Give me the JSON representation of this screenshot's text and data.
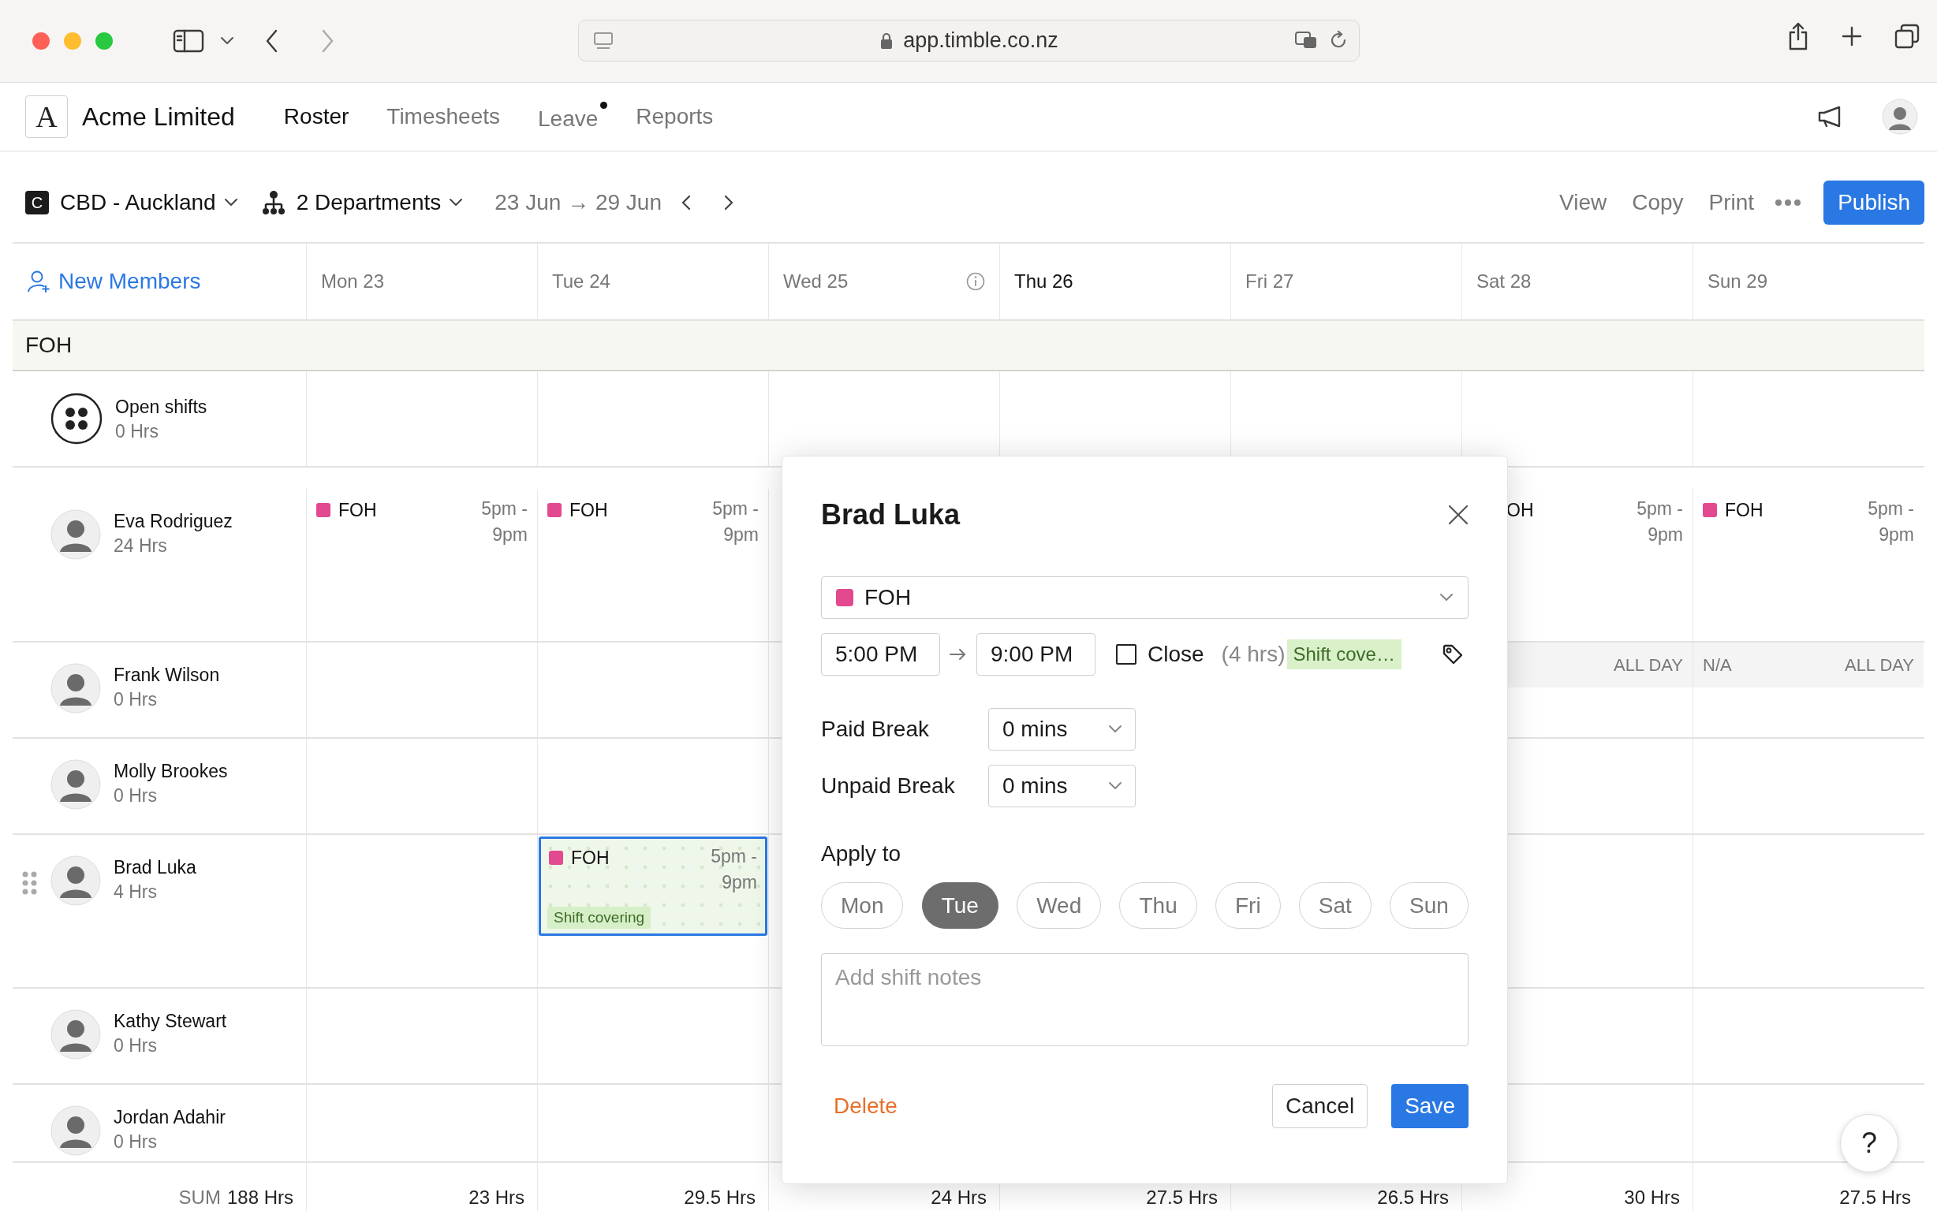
{
  "browser": {
    "url": "app.timble.co.nz"
  },
  "app": {
    "logo_letter": "A",
    "company": "Acme Limited",
    "nav": [
      {
        "label": "Roster",
        "selected": true,
        "notification": false
      },
      {
        "label": "Timesheets",
        "selected": false,
        "notification": false
      },
      {
        "label": "Leave",
        "selected": false,
        "notification": true
      },
      {
        "label": "Reports",
        "selected": false,
        "notification": false
      }
    ]
  },
  "toolbar": {
    "location_letter": "C",
    "location": "CBD - Auckland",
    "departments": "2 Departments",
    "date_range": "23 Jun → 29 Jun",
    "actions": [
      "View",
      "Copy",
      "Print"
    ],
    "publish": "Publish"
  },
  "roster": {
    "new_members": "New Members",
    "days": [
      {
        "label": "Mon 23",
        "today": false,
        "info": false
      },
      {
        "label": "Tue 24",
        "today": false,
        "info": false
      },
      {
        "label": "Wed 25",
        "today": false,
        "info": true
      },
      {
        "label": "Thu 26",
        "today": true,
        "info": false
      },
      {
        "label": "Fri 27",
        "today": false,
        "info": false
      },
      {
        "label": "Sat 28",
        "today": false,
        "info": false
      },
      {
        "label": "Sun 29",
        "today": false,
        "info": false
      }
    ],
    "groups": [
      {
        "name": "FOH",
        "rows": [
          {
            "kind": "open",
            "name": "Open shifts",
            "hours": "0 Hrs",
            "hover": false,
            "cells": [
              {
                "kind": "empty"
              },
              {
                "kind": "empty"
              },
              {
                "kind": "empty"
              },
              {
                "kind": "empty"
              },
              {
                "kind": "empty"
              },
              {
                "kind": "empty"
              },
              {
                "kind": "empty"
              }
            ]
          },
          {
            "kind": "member",
            "name": "Eva Rodriguez",
            "hours": "24 Hrs",
            "hover": false,
            "cells": [
              {
                "kind": "shift",
                "label": "FOH",
                "color": "#e2498f",
                "time": "5pm - 9pm",
                "selected": false
              },
              {
                "kind": "shift",
                "label": "FOH",
                "color": "#e2498f",
                "time": "5pm - 9pm",
                "selected": false
              },
              {
                "kind": "empty"
              },
              {
                "kind": "empty"
              },
              {
                "kind": "empty"
              },
              {
                "kind": "partial",
                "label": "OH",
                "time": "5pm - 9pm"
              },
              {
                "kind": "shift",
                "label": "FOH",
                "color": "#e2498f",
                "time": "5pm - 9pm",
                "selected": false
              }
            ]
          },
          {
            "kind": "member",
            "name": "Frank Wilson",
            "hours": "0 Hrs",
            "hover": false,
            "cells": [
              {
                "kind": "empty"
              },
              {
                "kind": "empty"
              },
              {
                "kind": "empty"
              },
              {
                "kind": "empty"
              },
              {
                "kind": "empty"
              },
              {
                "kind": "unavailable",
                "note": "ALL DAY"
              },
              {
                "kind": "unavailable",
                "label": "N/A",
                "note": "ALL DAY"
              }
            ]
          },
          {
            "kind": "member",
            "name": "Molly Brookes",
            "hours": "0 Hrs",
            "hover": false,
            "cells": [
              {
                "kind": "empty"
              },
              {
                "kind": "empty"
              },
              {
                "kind": "empty"
              },
              {
                "kind": "empty"
              },
              {
                "kind": "empty"
              },
              {
                "kind": "empty"
              },
              {
                "kind": "empty"
              }
            ]
          },
          {
            "kind": "member",
            "name": "Brad Luka",
            "hours": "4 Hrs",
            "hover": true,
            "cells": [
              {
                "kind": "empty"
              },
              {
                "kind": "shift",
                "label": "FOH",
                "color": "#e2498f",
                "time": "5pm - 9pm",
                "selected": true,
                "tag": "Shift covering"
              },
              {
                "kind": "empty"
              },
              {
                "kind": "empty"
              },
              {
                "kind": "empty"
              },
              {
                "kind": "empty"
              },
              {
                "kind": "empty"
              }
            ]
          },
          {
            "kind": "member",
            "name": "Kathy Stewart",
            "hours": "0 Hrs",
            "hover": false,
            "cells": [
              {
                "kind": "empty"
              },
              {
                "kind": "empty"
              },
              {
                "kind": "empty"
              },
              {
                "kind": "empty"
              },
              {
                "kind": "empty"
              },
              {
                "kind": "empty"
              },
              {
                "kind": "empty"
              }
            ]
          },
          {
            "kind": "member",
            "name": "Jordan Adahir",
            "hours": "0 Hrs",
            "hover": false,
            "cells": [
              {
                "kind": "empty"
              },
              {
                "kind": "empty"
              },
              {
                "kind": "empty"
              },
              {
                "kind": "empty"
              },
              {
                "kind": "empty"
              },
              {
                "kind": "empty"
              },
              {
                "kind": "empty"
              }
            ]
          }
        ]
      }
    ],
    "sum": {
      "label": "SUM",
      "total": "188 Hrs",
      "days": [
        "23 Hrs",
        "29.5 Hrs",
        "24 Hrs",
        "27.5 Hrs",
        "26.5 Hrs",
        "30 Hrs",
        "27.5 Hrs"
      ]
    }
  },
  "modal": {
    "title": "Brad Luka",
    "department": {
      "label": "FOH",
      "color": "#e2498f"
    },
    "start": "5:00 PM",
    "end": "9:00 PM",
    "close": {
      "label": "Close",
      "checked": false
    },
    "duration": "(4 hrs)",
    "tag": "Shift cove…",
    "breaks": [
      {
        "label": "Paid Break",
        "value": "0 mins"
      },
      {
        "label": "Unpaid Break",
        "value": "0 mins"
      }
    ],
    "apply_label": "Apply to",
    "apply_days": [
      {
        "label": "Mon",
        "selected": false
      },
      {
        "label": "Tue",
        "selected": true
      },
      {
        "label": "Wed",
        "selected": false
      },
      {
        "label": "Thu",
        "selected": false
      },
      {
        "label": "Fri",
        "selected": false
      },
      {
        "label": "Sat",
        "selected": false
      },
      {
        "label": "Sun",
        "selected": false
      }
    ],
    "notes_placeholder": "Add shift notes",
    "delete": "Delete",
    "cancel": "Cancel",
    "save": "Save"
  },
  "help": "?"
}
